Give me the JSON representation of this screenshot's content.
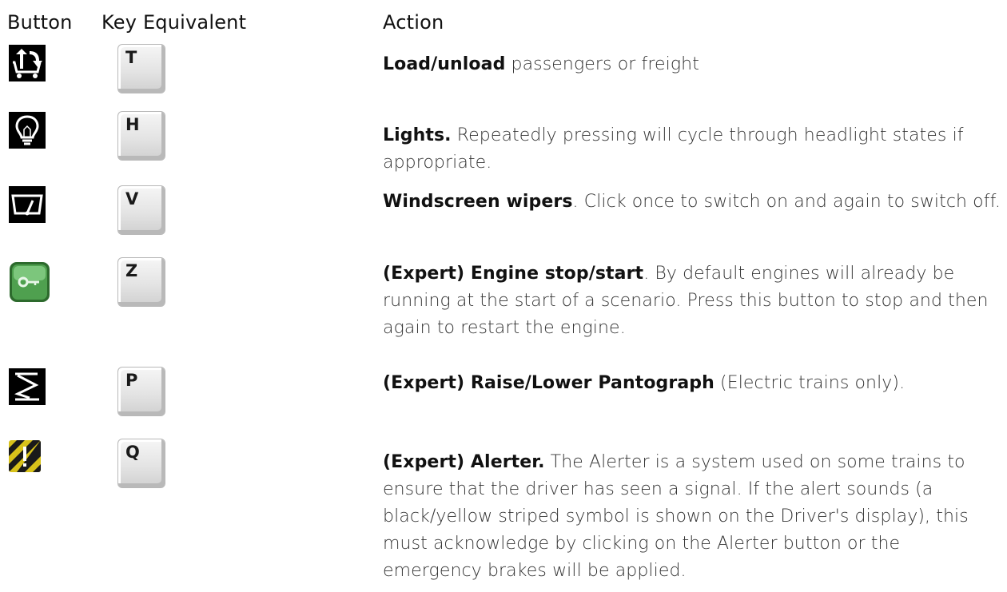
{
  "headers": {
    "button": "Button",
    "key": "Key Equivalent",
    "action": "Action"
  },
  "rows": [
    {
      "icon": "load-unload-icon",
      "key": "T",
      "action_bold": "Load/unload",
      "action_text": " passengers or freight"
    },
    {
      "icon": "lightbulb-icon",
      "key": "H",
      "action_bold": "Lights.",
      "action_text": " Repeatedly pressing will cycle through headlight states if appropriate."
    },
    {
      "icon": "wiper-icon",
      "key": "V",
      "action_bold": "Windscreen wipers",
      "action_text": ". Click once to switch on and again to switch off."
    },
    {
      "icon": "engine-key-icon",
      "key": "Z",
      "action_bold": "(Expert) Engine stop/start",
      "action_text": ". By default engines will already be running at the start of a scenario. Press this button to stop and then again to restart the engine."
    },
    {
      "icon": "pantograph-icon",
      "key": "P",
      "action_bold": "(Expert) Raise/Lower Pantograph",
      "action_text": " (Electric trains only)."
    },
    {
      "icon": "alerter-icon",
      "key": "Q",
      "action_bold": "(Expert) Alerter.",
      "action_text": " The Alerter is a system used on some trains to ensure that the driver has seen a signal. If the alert sounds (a black/yellow striped symbol is shown on the Driver's display), this must acknowledge by clicking on the Alerter button or the emergency brakes will be applied."
    }
  ],
  "colors": {
    "icon_bg": "#000000",
    "engine_green": "#3a8a3a",
    "alerter_yellow": "#d8c21a"
  }
}
